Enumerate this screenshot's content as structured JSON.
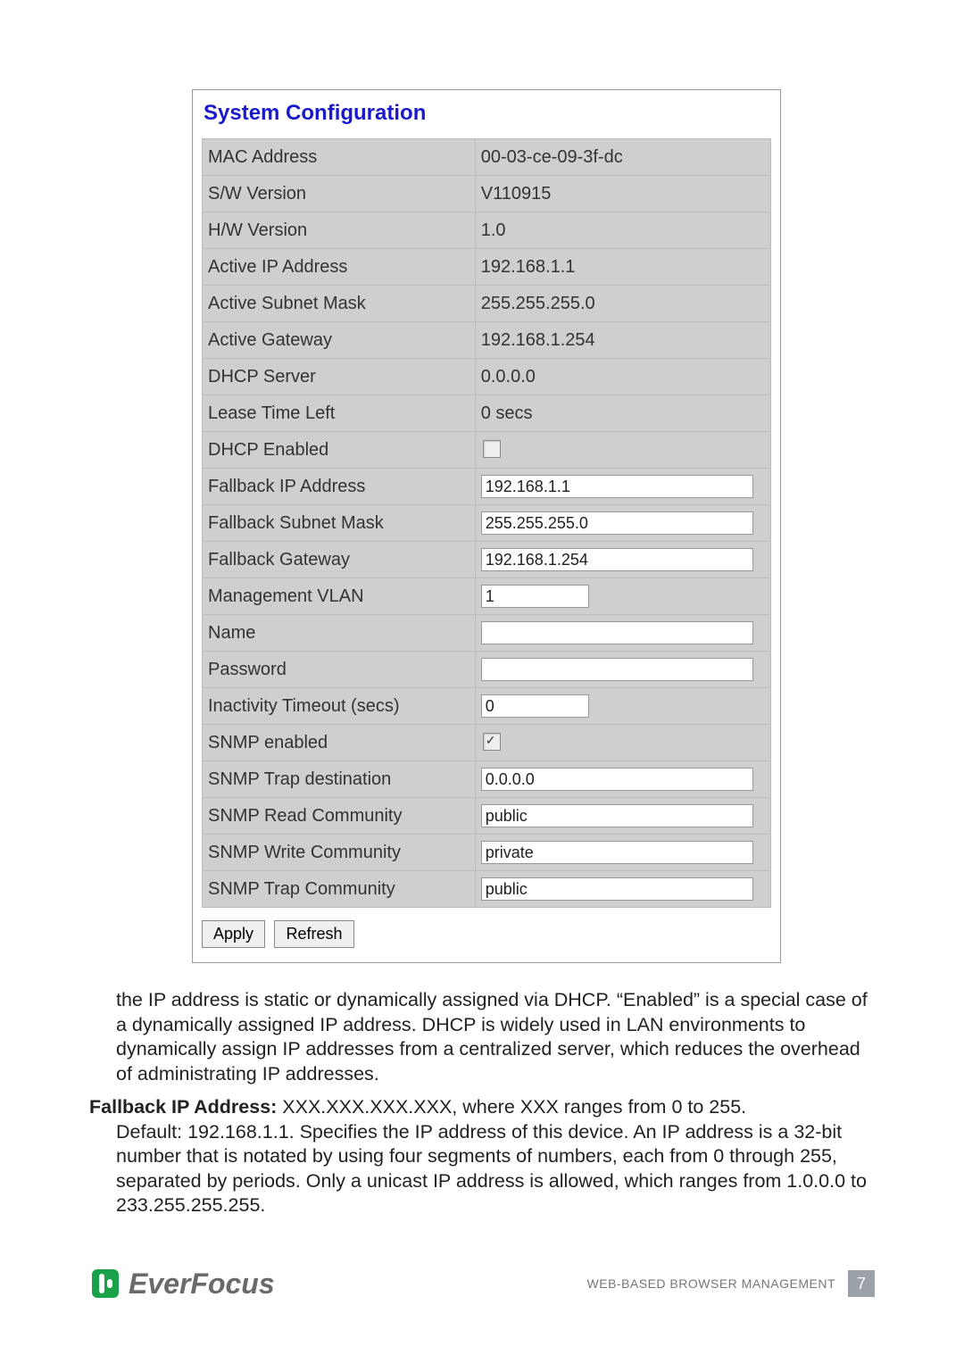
{
  "config": {
    "title": "System Configuration",
    "rows": {
      "mac": {
        "label": "MAC Address",
        "value": "00-03-ce-09-3f-dc"
      },
      "swv": {
        "label": "S/W Version",
        "value": "V110915"
      },
      "hwv": {
        "label": "H/W Version",
        "value": "1.0"
      },
      "aip": {
        "label": "Active IP Address",
        "value": "192.168.1.1"
      },
      "asm": {
        "label": "Active Subnet Mask",
        "value": "255.255.255.0"
      },
      "agw": {
        "label": "Active Gateway",
        "value": "192.168.1.254"
      },
      "dhcps": {
        "label": "DHCP Server",
        "value": "0.0.0.0"
      },
      "lease": {
        "label": "Lease Time Left",
        "value": "0 secs"
      },
      "dhcpen": {
        "label": "DHCP Enabled",
        "checked": false
      },
      "fip": {
        "label": "Fallback IP Address",
        "value": "192.168.1.1"
      },
      "fsm": {
        "label": "Fallback Subnet Mask",
        "value": "255.255.255.0"
      },
      "fgw": {
        "label": "Fallback Gateway",
        "value": "192.168.1.254"
      },
      "mvlan": {
        "label": "Management VLAN",
        "value": "1"
      },
      "name": {
        "label": "Name",
        "value": ""
      },
      "pwd": {
        "label": "Password",
        "value": ""
      },
      "ito": {
        "label": "Inactivity Timeout (secs)",
        "value": "0"
      },
      "snmpen": {
        "label": "SNMP enabled",
        "checked": true
      },
      "trapdst": {
        "label": "SNMP Trap destination",
        "value": "0.0.0.0"
      },
      "readc": {
        "label": "SNMP Read Community",
        "value": "public"
      },
      "writec": {
        "label": "SNMP Write Community",
        "value": "private"
      },
      "trapc": {
        "label": "SNMP Trap Community",
        "value": "public"
      }
    },
    "buttons": {
      "apply": "Apply",
      "refresh": "Refresh"
    }
  },
  "text": {
    "p1": "the IP address is static or dynamically assigned via DHCP. “Enabled” is a special case of a dynamically assigned IP address. DHCP is widely used in LAN environments to dynamically assign IP addresses from a centralized server, which reduces the overhead of administrating IP addresses.",
    "p2_bold": "Fallback IP Address: ",
    "p2_first": "XXX.XXX.XXX.XXX, where XXX ranges from 0 to 255.",
    "p2_rest": "Default: 192.168.1.1. Specifies the IP address of this device. An IP address is a 32-bit number that is notated by using four segments of numbers, each from 0 through 255, separated by periods. Only a unicast IP address is allowed, which ranges from 1.0.0.0 to 233.255.255.255."
  },
  "footer": {
    "brand": "EverFocus",
    "section": "WEB-BASED BROWSER MANAGEMENT",
    "page": "7"
  }
}
